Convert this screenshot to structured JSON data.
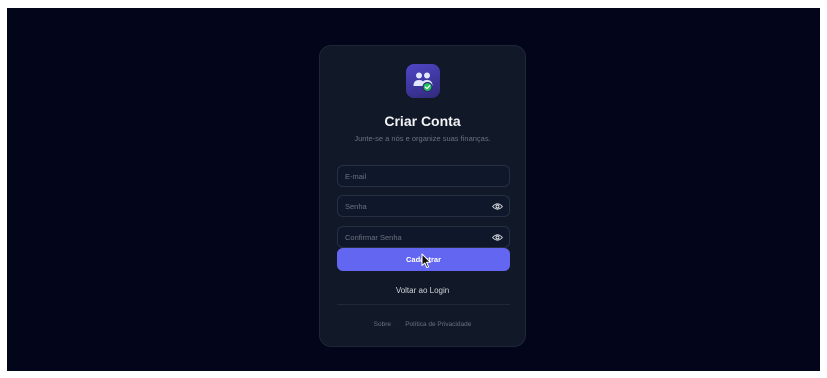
{
  "register": {
    "title": "Criar Conta",
    "subtitle": "Junte-se a nós e organize suas finanças.",
    "email_placeholder": "E-mail",
    "password_placeholder": "Senha",
    "confirm_placeholder": "Confirmar Senha",
    "submit_label": "Cadastrar",
    "back_label": "Voltar ao Login"
  },
  "footer": {
    "about_label": "Sobre",
    "separator": "·",
    "privacy_label": "Política de Privacidade"
  },
  "icons": {
    "logo": "users-check-icon",
    "password_toggle": "eye-icon",
    "confirm_toggle": "eye-icon",
    "cursor": "mouse-pointer-icon"
  },
  "colors": {
    "background": "#03061a",
    "card": "#111827",
    "accent": "#6366f1",
    "success": "#22c55e"
  }
}
